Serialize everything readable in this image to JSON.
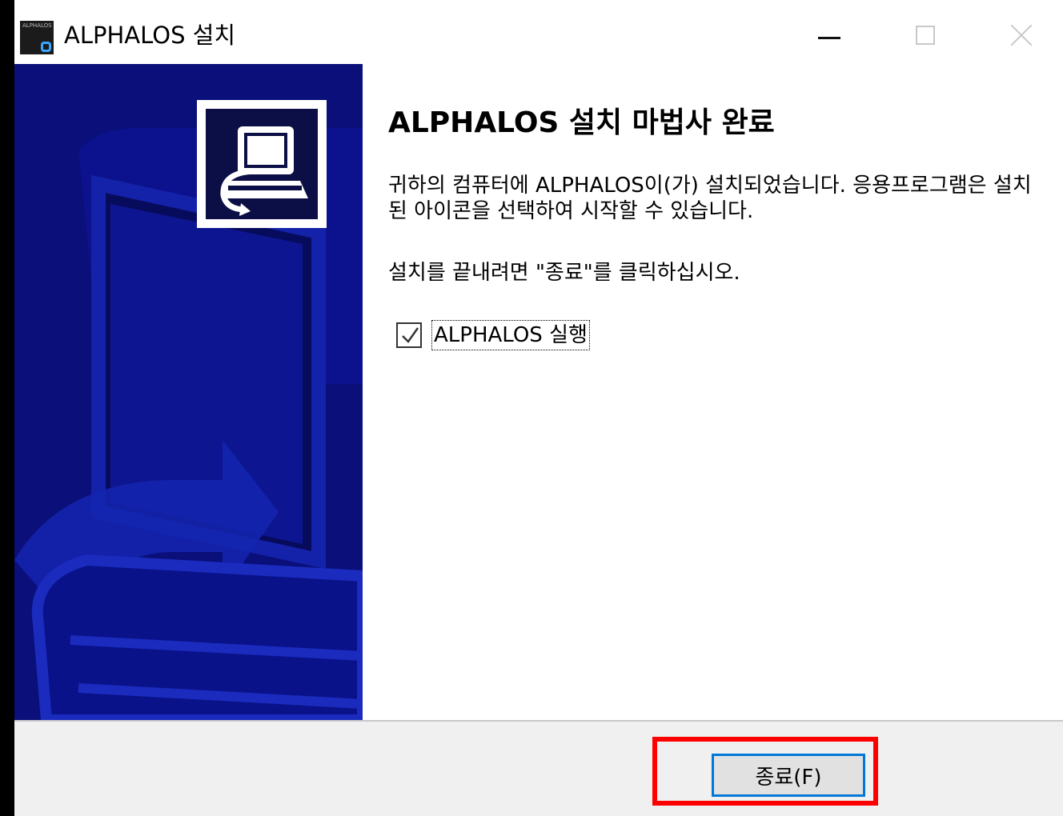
{
  "window": {
    "title": "ALPHALOS 설치",
    "icon_text": "ALPHALOS"
  },
  "main": {
    "heading": "ALPHALOS 설치 마법사 완료",
    "paragraph1": "귀하의 컴퓨터에 ALPHALOS이(가) 설치되었습니다. 응용프로그램은 설치된 아이콘을 선택하여 시작할 수 있습니다.",
    "paragraph2": "설치를 끝내려면 \"종료\"를 클릭하십시오.",
    "run_checkbox": {
      "label": "ALPHALOS 실행",
      "checked": true
    }
  },
  "footer": {
    "finish_label": "종료(F)"
  },
  "colors": {
    "side_panel": "#0a0f7a",
    "button_border": "#0078d7",
    "highlight": "#ff0000"
  }
}
